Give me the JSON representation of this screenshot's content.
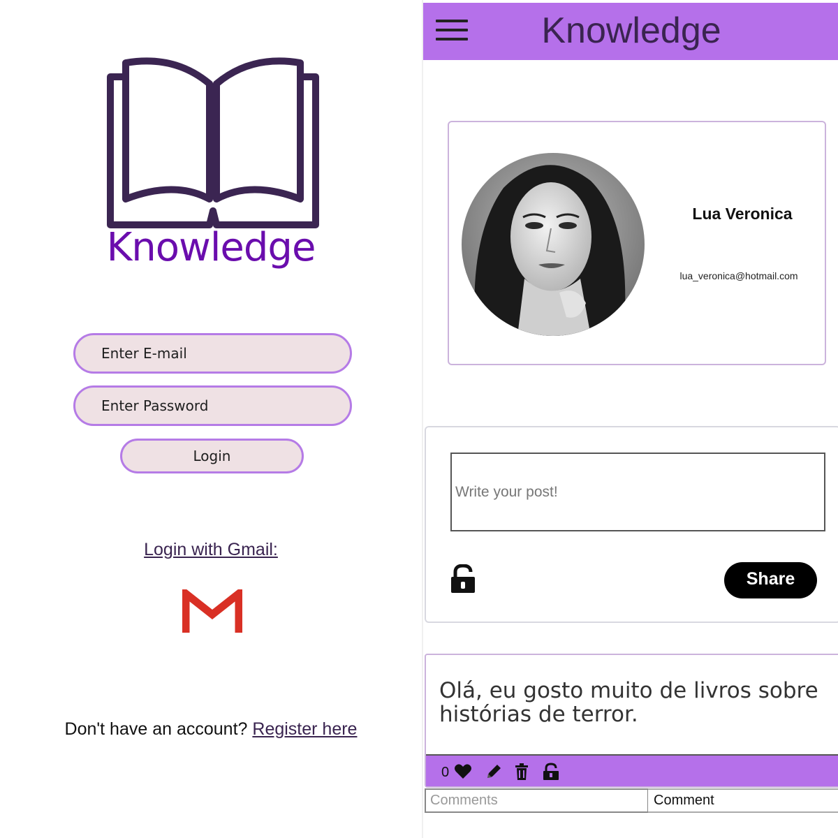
{
  "login": {
    "brand": "Knowledge",
    "email_placeholder": "Enter E-mail",
    "password_placeholder": "Enter Password",
    "login_label": "Login",
    "gmail_link": "Login with Gmail:",
    "register_prompt": "Don't have an account?",
    "register_link": "Register here",
    "icons": {
      "logo": "open-book-icon",
      "gmail": "gmail-icon"
    },
    "colors": {
      "brand": "#6a0dad",
      "field_bg": "#efe1e4",
      "field_border": "#b57be6",
      "logo": "#3b2552"
    }
  },
  "feed": {
    "header": {
      "title": "Knowledge",
      "menu_icon": "hamburger-menu-icon"
    },
    "profile": {
      "name": "Lua Veronica",
      "email": "lua_veronica@hotmail.com",
      "avatar_icon": "avatar-photo"
    },
    "composer": {
      "placeholder": "Write your post!",
      "share_label": "Share",
      "privacy_icon": "unlock-icon"
    },
    "post": {
      "text": "Olá, eu gosto muito de livros sobre histórias de terror.",
      "likes": "0",
      "actions": [
        "heart-icon",
        "pencil-icon",
        "trash-icon",
        "unlock-icon"
      ],
      "comment_placeholder": "Comments",
      "comment_label": "Comment"
    },
    "colors": {
      "accent": "#b570ea",
      "title": "#3a2450",
      "share_bg": "#000000"
    }
  }
}
